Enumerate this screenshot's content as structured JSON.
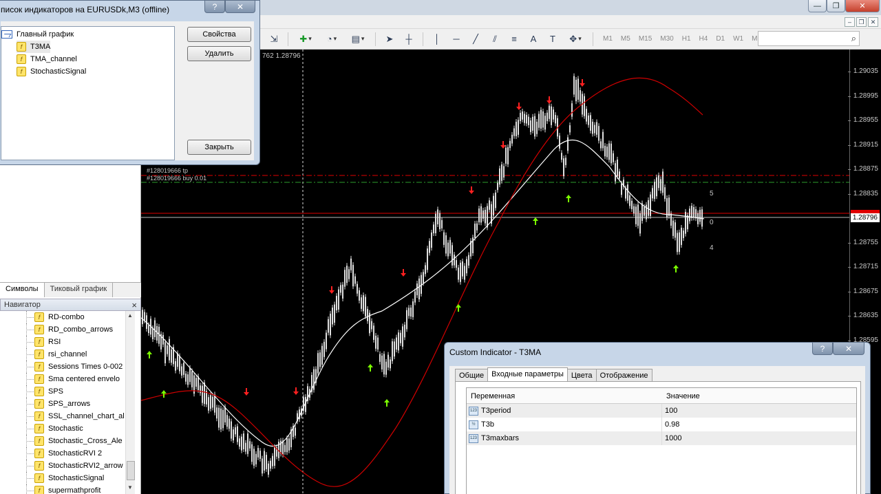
{
  "indicator_list_dialog": {
    "title": "писок индикаторов на EURUSDk,M3 (offline)",
    "help_glyph": "?",
    "close_glyph": "✕",
    "tree_root": "Главный график",
    "tree_items": [
      "T3MA",
      "TMA_channel",
      "StochasticSignal"
    ],
    "buttons": {
      "properties": "Свойства",
      "delete": "Удалить",
      "close": "Закрыть"
    }
  },
  "main_window": {
    "controls": {
      "minimize": "—",
      "restore": "❐",
      "close": "✕"
    },
    "mdi_controls": {
      "minimize": "–",
      "restore": "❐",
      "close": "✕"
    }
  },
  "toolbar": {
    "timeframes": [
      "M1",
      "M5",
      "M15",
      "M30",
      "H1",
      "H4",
      "D1",
      "W1",
      "MN"
    ],
    "search_placeholder": "",
    "search_icon": "magnifier-icon"
  },
  "left_panel": {
    "tabs": [
      "Символы",
      "Тиковый график"
    ],
    "navigator_title": "Навигатор",
    "navigator_close": "×",
    "navigator_items": [
      "RD-combo",
      "RD_combo_arrows",
      "RSI",
      "rsi_channel",
      "Sessions Times 0-002",
      "Sma centered envelo",
      "SPS",
      "SPS_arrows",
      "SSL_channel_chart_al",
      "Stochastic",
      "Stochastic_Cross_Ale",
      "StochasticRVI 2",
      "StochasticRVI2_arrow",
      "StochasticSignal",
      "supermathprofit"
    ]
  },
  "chart": {
    "info_text": "762 1.28796",
    "trade_labels": [
      "#128019666 tp",
      "#128019666 buy 0.01"
    ],
    "price_ticks": [
      "1.29035",
      "1.28995",
      "1.28955",
      "1.28915",
      "1.28875",
      "1.28835",
      "1.28755",
      "1.28715",
      "1.28675",
      "1.28635",
      "1.28595"
    ],
    "current_price": "1.28796",
    "side_numbers": [
      "5",
      "0",
      "4"
    ],
    "colors": {
      "background": "#000000",
      "candles": "#e0e0e0",
      "ma_white": "#ffffff",
      "channel_red": "#d00000",
      "up_arrow": "#7cff00",
      "down_arrow": "#ff2020"
    }
  },
  "custom_indicator_dialog": {
    "title": "Custom Indicator - T3MA",
    "help_glyph": "?",
    "close_glyph": "✕",
    "tabs": [
      "Общие",
      "Входные параметры",
      "Цвета",
      "Отображение"
    ],
    "columns": [
      "Переменная",
      "Значение"
    ],
    "params": [
      {
        "icon": "123",
        "name": "T3period",
        "value": "100"
      },
      {
        "icon": "½",
        "name": "T3b",
        "value": "0.98"
      },
      {
        "icon": "123",
        "name": "T3maxbars",
        "value": "1000"
      }
    ]
  }
}
